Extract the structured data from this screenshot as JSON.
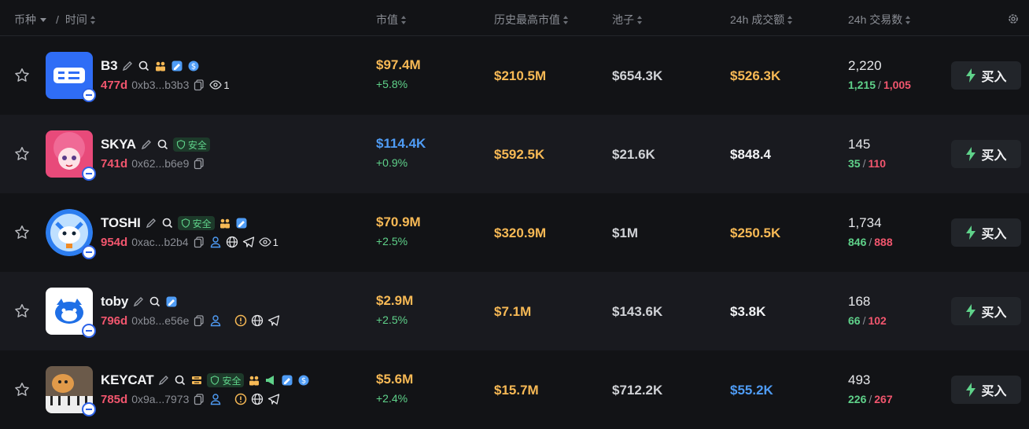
{
  "header": {
    "coin": "币种",
    "time": "时间",
    "market_cap": "市值",
    "ath_market_cap": "历史最高市值",
    "pool": "池子",
    "volume_24h": "24h 成交额",
    "txns_24h": "24h 交易数"
  },
  "colors": {
    "green": "#5fd28a",
    "red": "#f2566e",
    "orange": "#f7b955",
    "blue": "#4f9cf5",
    "white": "#f2f3f5"
  },
  "rows": [
    {
      "name": "B3",
      "age": "477d",
      "address": "0xb3...b3b3",
      "watchers": "1",
      "market_cap": "$97.4M",
      "market_cap_change": "+5.8%",
      "ath": "$210.5M",
      "pool": "$654.3K",
      "volume": "$526.3K",
      "txns": "2,220",
      "buys": "1,215",
      "sells": "1,005",
      "buy_label": "买入"
    },
    {
      "name": "SKYA",
      "age": "741d",
      "address": "0x62...b6e9",
      "safe": "安全",
      "market_cap": "$114.4K",
      "market_cap_change": "+0.9%",
      "ath": "$592.5K",
      "pool": "$21.6K",
      "volume": "$848.4",
      "txns": "145",
      "buys": "35",
      "sells": "110",
      "buy_label": "买入"
    },
    {
      "name": "TOSHI",
      "age": "954d",
      "address": "0xac...b2b4",
      "safe": "安全",
      "watchers": "1",
      "market_cap": "$70.9M",
      "market_cap_change": "+2.5%",
      "ath": "$320.9M",
      "pool": "$1M",
      "volume": "$250.5K",
      "txns": "1,734",
      "buys": "846",
      "sells": "888",
      "buy_label": "买入"
    },
    {
      "name": "toby",
      "age": "796d",
      "address": "0xb8...e56e",
      "market_cap": "$2.9M",
      "market_cap_change": "+2.5%",
      "ath": "$7.1M",
      "pool": "$143.6K",
      "volume": "$3.8K",
      "txns": "168",
      "buys": "66",
      "sells": "102",
      "buy_label": "买入"
    },
    {
      "name": "KEYCAT",
      "age": "785d",
      "address": "0x9a...7973",
      "safe": "安全",
      "market_cap": "$5.6M",
      "market_cap_change": "+2.4%",
      "ath": "$15.7M",
      "pool": "$712.2K",
      "volume": "$55.2K",
      "txns": "493",
      "buys": "226",
      "sells": "267",
      "buy_label": "买入"
    }
  ],
  "sep": "/"
}
